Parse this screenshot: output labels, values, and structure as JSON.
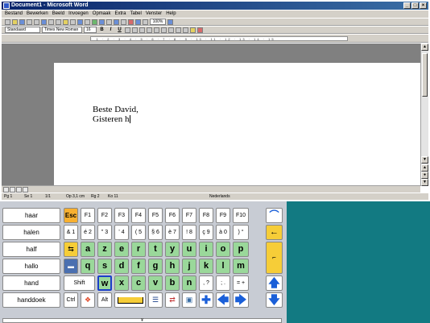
{
  "window": {
    "title": "Document1 - Microsoft Word",
    "buttons": [
      "_",
      "□",
      "×"
    ]
  },
  "menu": [
    "Bestand",
    "Bewerken",
    "Beeld",
    "Invoegen",
    "Opmaak",
    "Extra",
    "Tabel",
    "Venster",
    "Help"
  ],
  "toolbar": {
    "style": "Standaard",
    "font": "Times New Roman",
    "size": "16",
    "bold": "B",
    "italic": "I",
    "underline": "U",
    "zoom": "100%"
  },
  "document": {
    "line1": "Beste David,",
    "line2": "Gisteren h"
  },
  "status": {
    "page": "Pg 1",
    "section": "Se 1",
    "pages": "1/1",
    "position": "Op 3,1 cm",
    "line": "Rg 2",
    "column": "Ko 11",
    "language": "Nederlands"
  },
  "keyboard": {
    "words": [
      "haar",
      "halen",
      "half",
      "hallo",
      "hand",
      "handdoek"
    ],
    "row1": [
      "Esc",
      "F1",
      "F2",
      "F3",
      "F4",
      "F5",
      "F6",
      "F7",
      "F8",
      "F9",
      "F10"
    ],
    "row2": [
      "& 1",
      "é 2",
      "\" 3",
      "' 4",
      "( 5",
      "§ 6",
      "è 7",
      "! 8",
      "ç 9",
      "à 0",
      ") °"
    ],
    "row3": [
      "a",
      "z",
      "e",
      "r",
      "t",
      "y",
      "u",
      "i",
      "o",
      "p"
    ],
    "row4": [
      "q",
      "s",
      "d",
      "f",
      "g",
      "h",
      "j",
      "k",
      "l",
      "m"
    ],
    "row5_shift": "Shift",
    "row5": [
      "w",
      "x",
      "c",
      "v",
      "b",
      "n",
      ", ?",
      "; .",
      "= +"
    ],
    "row6_ctrl": "Ctrl",
    "row6_alt": "Alt",
    "arrows": {
      "up": "🡅",
      "left": "🡄",
      "right": "🡆",
      "down": "🡇"
    },
    "enter_row2": "←",
    "bottom": "¥"
  },
  "colors": {
    "titlebar": "#0a246a",
    "letter_key": "#9ad89a",
    "orange_key": "#f6cd38",
    "teal": "#127a82",
    "arrow_blue": "#1a5fd8"
  }
}
